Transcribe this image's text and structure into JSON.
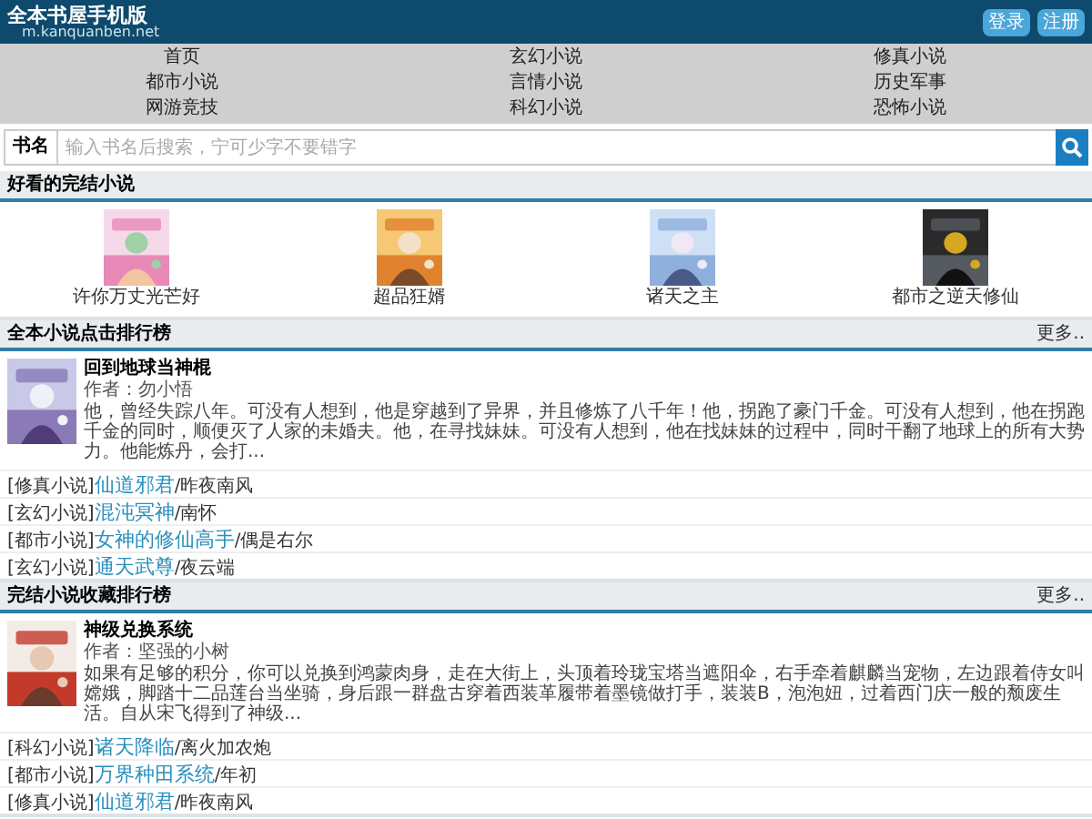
{
  "header": {
    "title": "全本书屋手机版",
    "domain": "m.kanquanben.net",
    "buttons": [
      "登录",
      "注册"
    ]
  },
  "nav": [
    "首页",
    "玄幻小说",
    "修真小说",
    "都市小说",
    "言情小说",
    "历史军事",
    "网游竞技",
    "科幻小说",
    "恐怖小说"
  ],
  "search": {
    "label": "书名",
    "placeholder": "输入书名后搜索，宁可少字不要错字"
  },
  "sections": [
    {
      "kind": "covers",
      "title": "好看的完结小说",
      "books": [
        {
          "title": "许你万丈光芒好",
          "kind": "picture"
        },
        {
          "title": "超品狂婿",
          "kind": "picture"
        },
        {
          "title": "诸天之主",
          "kind": "picture"
        },
        {
          "title": "都市之逆天修仙",
          "kind": "picture"
        }
      ]
    },
    {
      "kind": "ranking",
      "title": "全本小说点击排行榜",
      "more": "更多..",
      "featured": {
        "title": "回到地球当神棍",
        "author": "作者：勿小悟",
        "description": "他，曾经失踪八年。可没有人想到，他是穿越到了异界，并且修炼了八千年！他，拐跑了豪门千金。可没有人想到，他在拐跑千金的同时，顺便灭了人家的未婚夫。他，在寻找妹妹。可没有人想到，他在找妹妹的过程中，同时干翻了地球上的所有大势力。他能炼丹，会打..."
      },
      "items": [
        {
          "category": "[修真小说]",
          "title": "仙道邪君",
          "author": "/昨夜南风"
        },
        {
          "category": "[玄幻小说]",
          "title": "混沌冥神",
          "author": "/南怀"
        },
        {
          "category": "[都市小说]",
          "title": "女神的修仙高手",
          "author": "/偶是右尔"
        },
        {
          "category": "[玄幻小说]",
          "title": "通天武尊",
          "author": "/夜云端"
        }
      ]
    },
    {
      "kind": "ranking",
      "title": "完结小说收藏排行榜",
      "more": "更多..",
      "featured": {
        "title": "神级兑换系统",
        "author": "作者：坚强的小树",
        "description": "如果有足够的积分，你可以兑换到鸿蒙肉身，走在大街上，头顶着玲珑宝塔当遮阳伞，右手牵着麒麟当宠物，左边跟着侍女叫嫦娥，脚踏十二品莲台当坐骑，身后跟一群盘古穿着西装革履带着墨镜做打手，装装B，泡泡妞，过着西门庆一般的颓废生活。自从宋飞得到了神级..."
      },
      "items": [
        {
          "category": "[科幻小说]",
          "title": "诸天降临",
          "author": "/离火加农炮"
        },
        {
          "category": "[都市小说]",
          "title": "万界种田系统",
          "author": "/年初"
        },
        {
          "category": "[修真小说]",
          "title": "仙道邪君",
          "author": "/昨夜南风"
        }
      ]
    }
  ]
}
